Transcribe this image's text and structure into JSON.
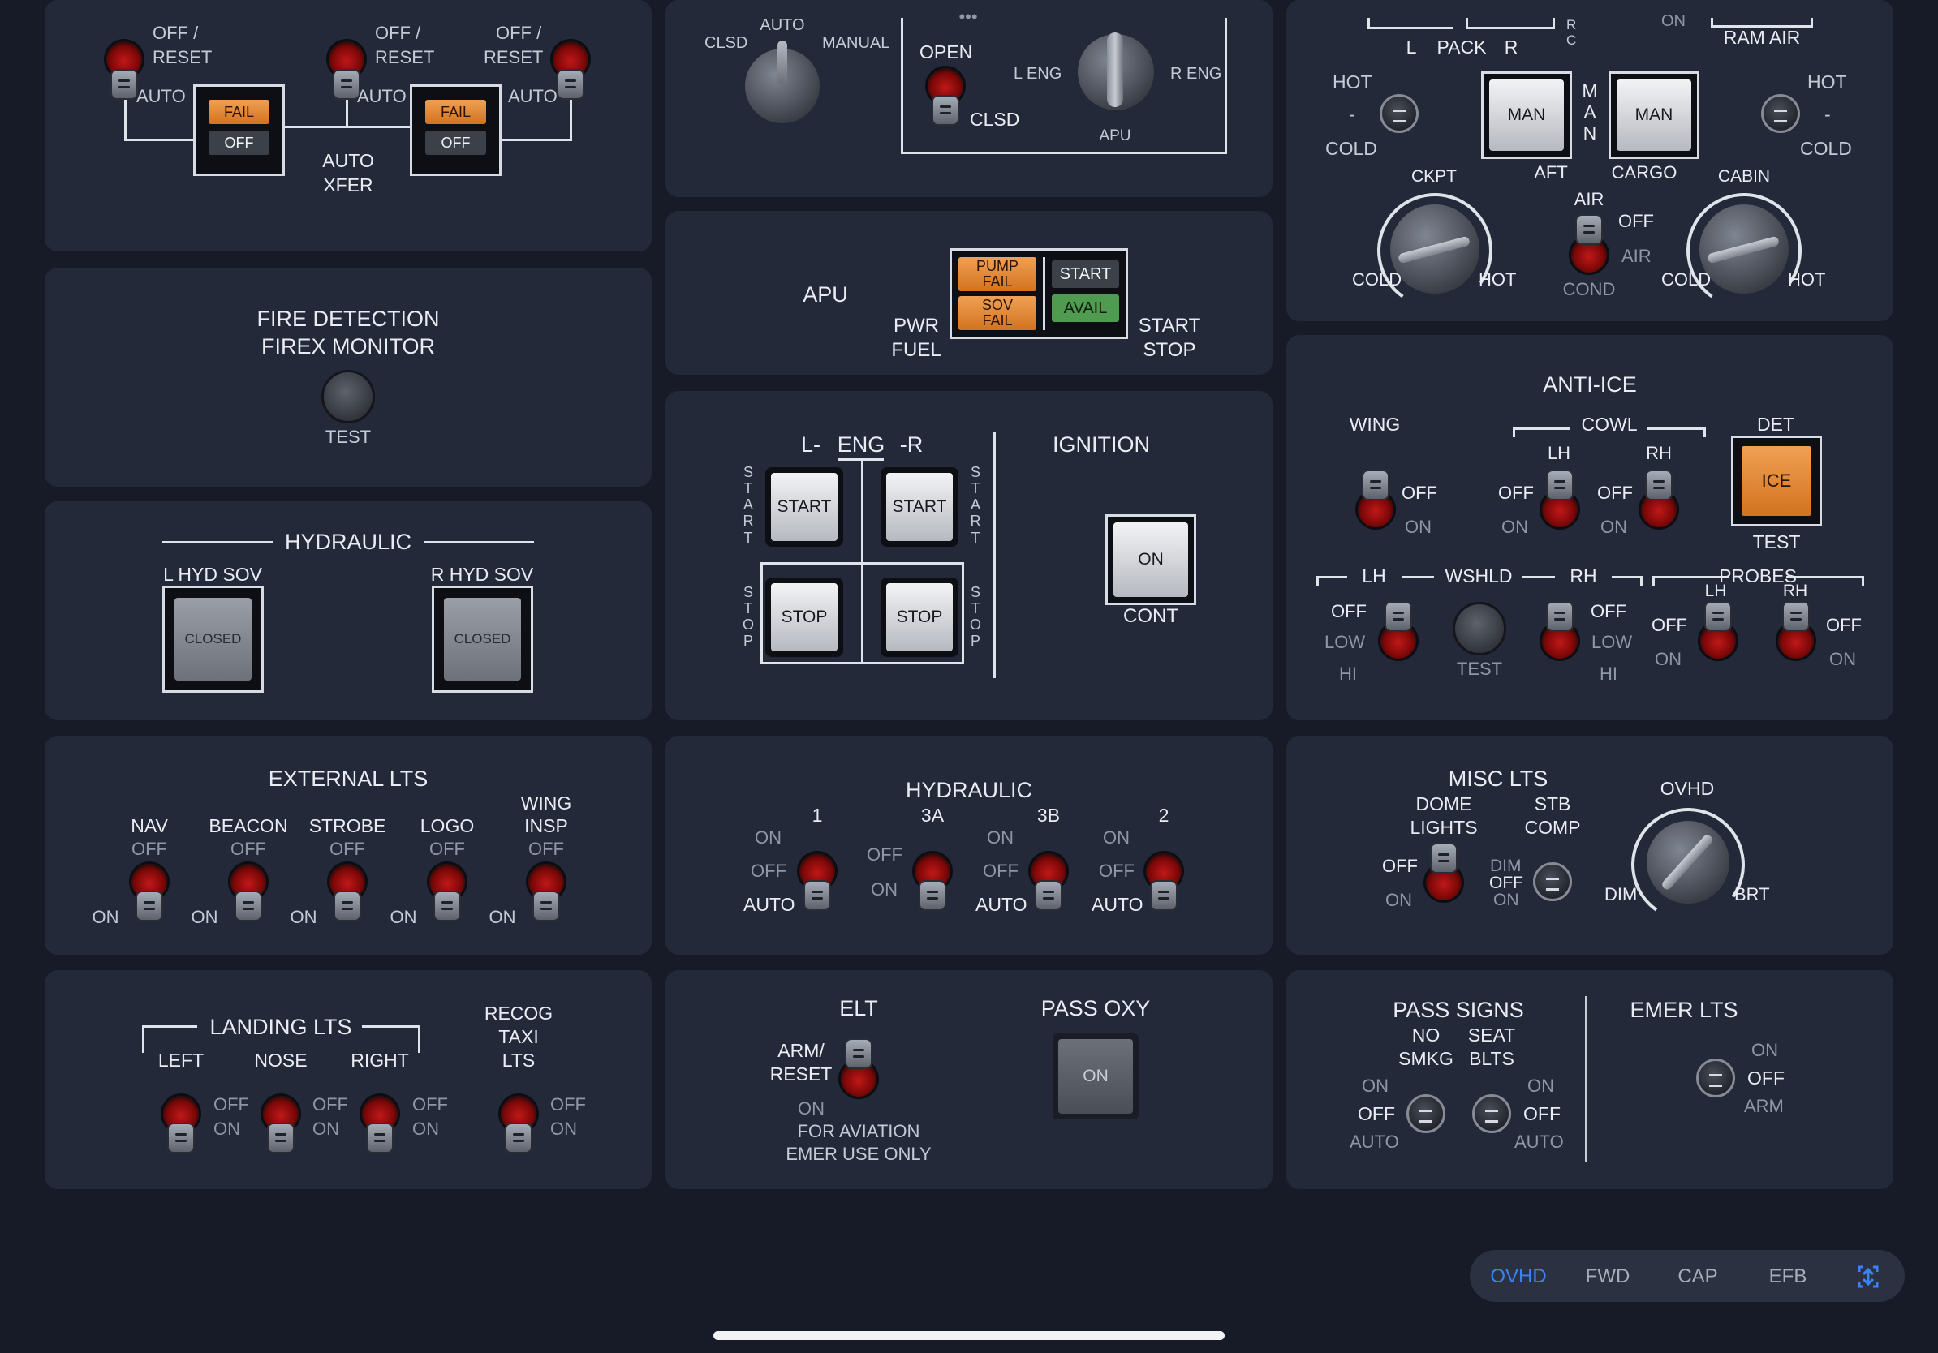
{
  "top_left": {
    "off_reset_1": "OFF /",
    "off_reset_2": "RESET",
    "auto": "AUTO",
    "fail": "FAIL",
    "off": "OFF",
    "auto_xfer_1": "AUTO",
    "auto_xfer_2": "XFER"
  },
  "top_mid": {
    "clsd": "CLSD",
    "auto": "AUTO",
    "manual": "MANUAL",
    "open": "OPEN",
    "clsd2": "CLSD",
    "l_eng": "L ENG",
    "r_eng": "R ENG",
    "apu": "APU",
    "dots": "•••"
  },
  "top_right": {
    "l": "L",
    "pack": "PACK",
    "r": "R",
    "rc": "R\nC",
    "on": "ON",
    "ram_air": "RAM AIR",
    "hot": "HOT",
    "dash": "-",
    "cold": "COLD",
    "man": "MAN",
    "man_vert": "M\nA\nN",
    "aft": "AFT",
    "cargo": "CARGO",
    "ckpt": "CKPT",
    "cabin": "CABIN",
    "air": "AIR",
    "off": "OFF",
    "air_cond_1": "AIR",
    "air_cond_2": "COND"
  },
  "fire": {
    "title_1": "FIRE DETECTION",
    "title_2": "FIREX MONITOR",
    "test": "TEST"
  },
  "apu": {
    "label": "APU",
    "pwr": "PWR",
    "fuel": "FUEL",
    "pump_fail": "PUMP\nFAIL",
    "sov_fail": "SOV\nFAIL",
    "start": "START",
    "avail": "AVAIL",
    "start_lbl": "START",
    "stop_lbl": "STOP"
  },
  "hyd_sov": {
    "title": "HYDRAULIC",
    "l": "L HYD SOV",
    "r": "R HYD SOV",
    "closed": "CLOSED"
  },
  "eng": {
    "l": "L-",
    "eng": "ENG",
    "r": "-R",
    "start": "START",
    "stop": "STOP",
    "start_v": "S\nT\nA\nR\nT",
    "stop_v": "S\nT\nO\nP",
    "ignition": "IGNITION",
    "on": "ON",
    "cont": "CONT"
  },
  "anti_ice": {
    "title": "ANTI-ICE",
    "wing": "WING",
    "cowl": "COWL",
    "lh": "LH",
    "rh": "RH",
    "det": "DET",
    "ice": "ICE",
    "test": "TEST",
    "off": "OFF",
    "on": "ON",
    "wshld": "WSHLD",
    "probes": "PROBES",
    "low": "LOW",
    "hi": "HI"
  },
  "ext_lts": {
    "title": "EXTERNAL LTS",
    "nav": "NAV",
    "beacon": "BEACON",
    "strobe": "STROBE",
    "logo": "LOGO",
    "wing_1": "WING",
    "wing_2": "INSP",
    "off": "OFF",
    "on": "ON"
  },
  "hydraulic": {
    "title": "HYDRAULIC",
    "p1": "1",
    "p3a": "3A",
    "p3b": "3B",
    "p2": "2",
    "on": "ON",
    "off": "OFF",
    "auto": "AUTO"
  },
  "misc_lts": {
    "title": "MISC LTS",
    "dome_1": "DOME",
    "dome_2": "LIGHTS",
    "stb_1": "STB",
    "stb_2": "COMP",
    "off": "OFF",
    "on": "ON",
    "dim": "DIM",
    "ovhd": "OVHD",
    "brt": "BRT"
  },
  "landing": {
    "title": "LANDING LTS",
    "left": "LEFT",
    "nose": "NOSE",
    "right": "RIGHT",
    "recog_1": "RECOG",
    "recog_2": "TAXI",
    "recog_3": "LTS",
    "off": "OFF",
    "on": "ON"
  },
  "elt": {
    "title": "ELT",
    "arm_1": "ARM/",
    "arm_2": "RESET",
    "on": "ON",
    "note_1": "FOR AVIATION",
    "note_2": "EMER USE ONLY",
    "oxy": "PASS OXY",
    "oxy_on": "ON"
  },
  "signs": {
    "title": "PASS SIGNS",
    "no_1": "NO",
    "no_2": "SMKG",
    "seat_1": "SEAT",
    "seat_2": "BLTS",
    "on": "ON",
    "off": "OFF",
    "auto": "AUTO",
    "emer": "EMER LTS",
    "arm": "ARM"
  },
  "tabs": [
    {
      "label": "OVHD"
    },
    {
      "label": "FWD"
    },
    {
      "label": "CAP"
    },
    {
      "label": "EFB"
    }
  ],
  "tabs_active": "OVHD",
  "colors": {
    "accent": "#3b82f6",
    "amber": "#e08a38",
    "green": "#4f9b4f",
    "panel": "#232939"
  }
}
